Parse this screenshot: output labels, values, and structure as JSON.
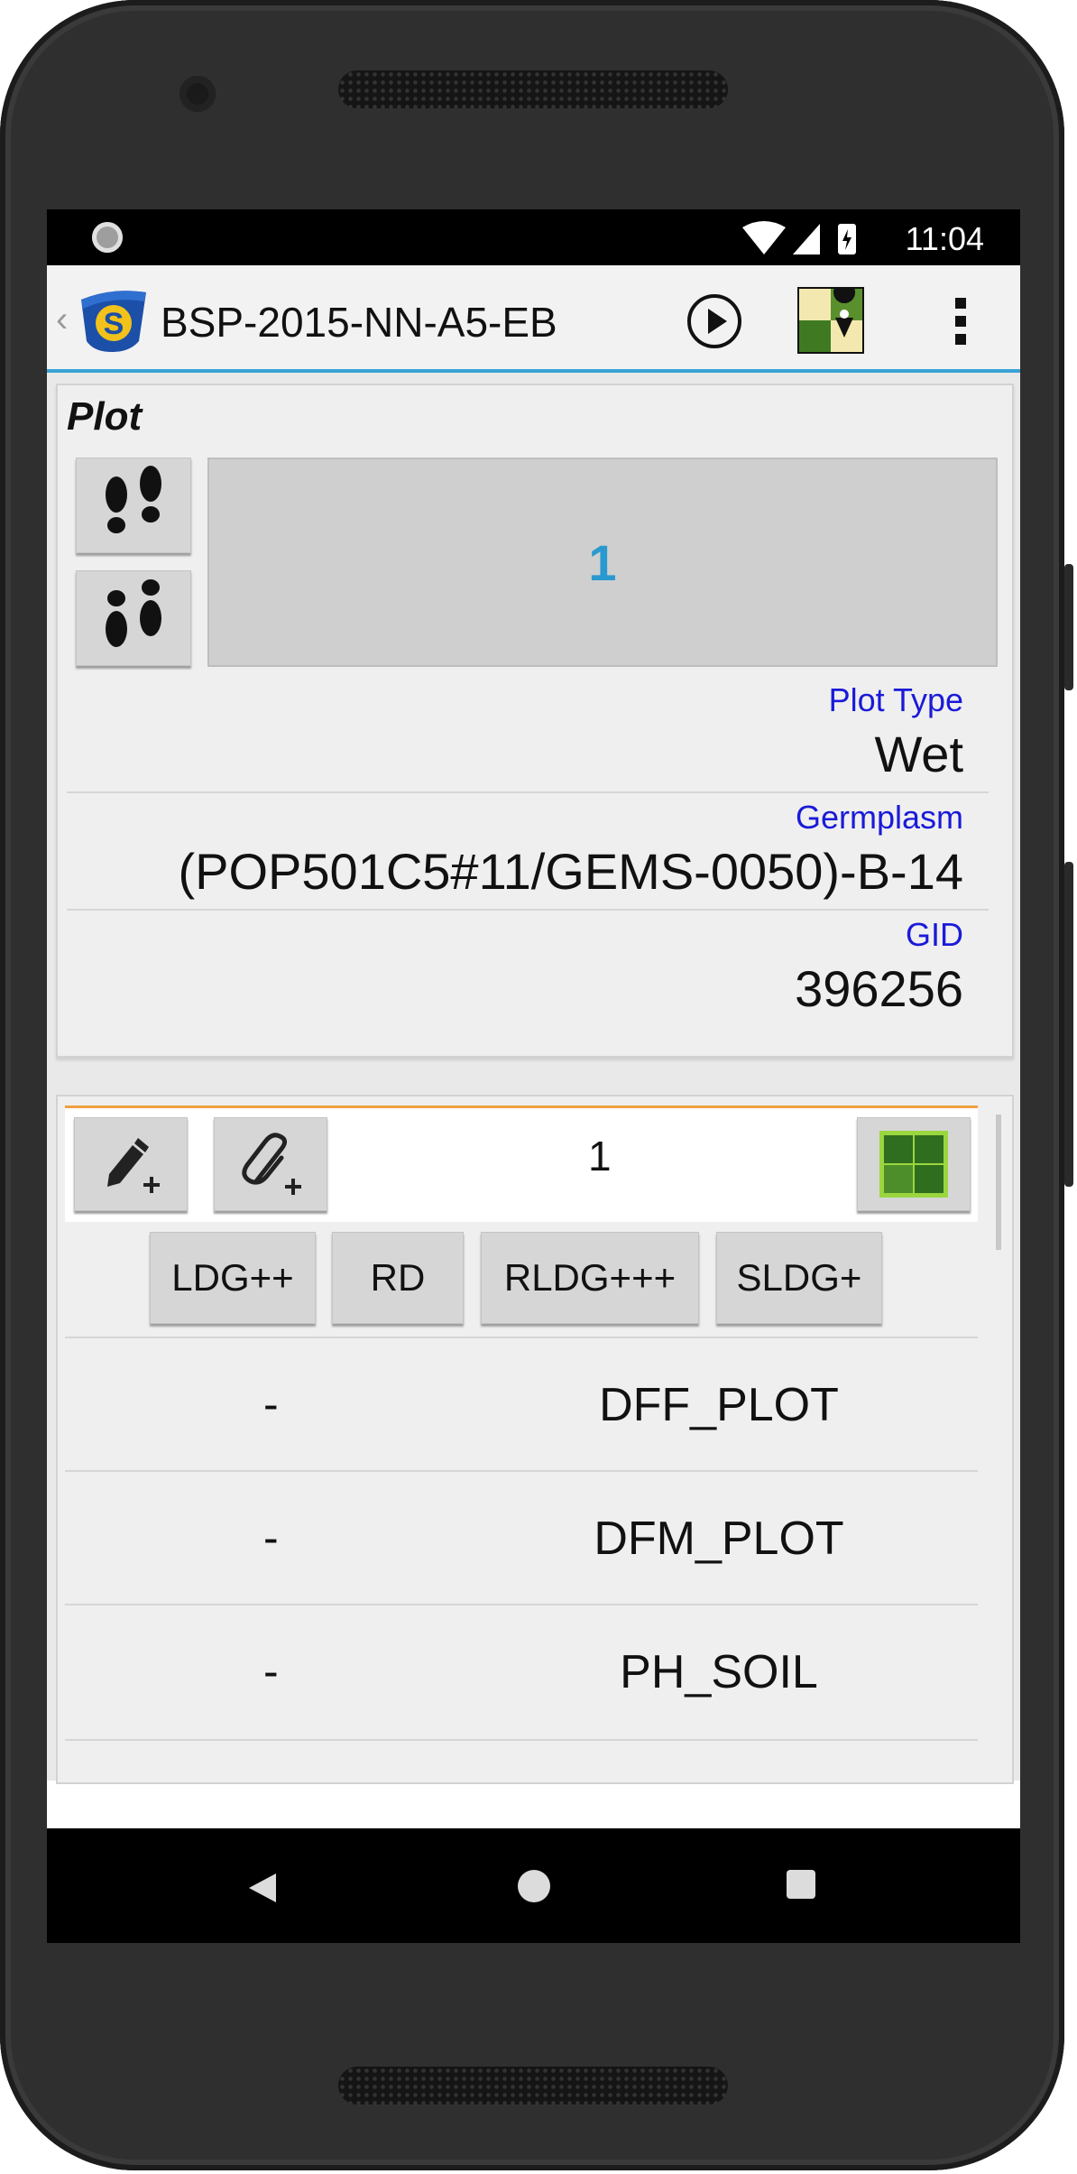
{
  "status_bar": {
    "time": "11:04"
  },
  "app_bar": {
    "title": "BSP-2015-NN-A5-EB",
    "back": "‹"
  },
  "plot_card": {
    "heading": "Plot",
    "plot_number": "1",
    "fields": [
      {
        "label": "Plot Type",
        "value": "Wet"
      },
      {
        "label": "Germplasm",
        "value": "(POP501C5#11/GEMS-0050)-B-14"
      },
      {
        "label": "GID",
        "value": "396256"
      }
    ]
  },
  "trait_panel": {
    "counter": "1",
    "categories": [
      "LDG++",
      "RD",
      "RLDG+++",
      "SLDG+"
    ],
    "traits": [
      {
        "value": "-",
        "name": "DFF_PLOT"
      },
      {
        "value": "-",
        "name": "DFM_PLOT"
      },
      {
        "value": "-",
        "name": "PH_SOIL"
      }
    ]
  },
  "colors": {
    "accent_blue": "#3aa3d6",
    "plot_number": "#2a99d0",
    "label_blue": "#1a1ad8",
    "map_green": "#2f6e1f",
    "toolbar_orange": "#f0a040"
  },
  "icons": [
    "app-logo",
    "play-icon",
    "map-icon",
    "overflow-icon",
    "footprints-forward-icon",
    "footprints-backward-icon",
    "edit-add-icon",
    "attach-add-icon",
    "grid-icon",
    "wifi-icon",
    "signal-icon",
    "battery-icon"
  ]
}
